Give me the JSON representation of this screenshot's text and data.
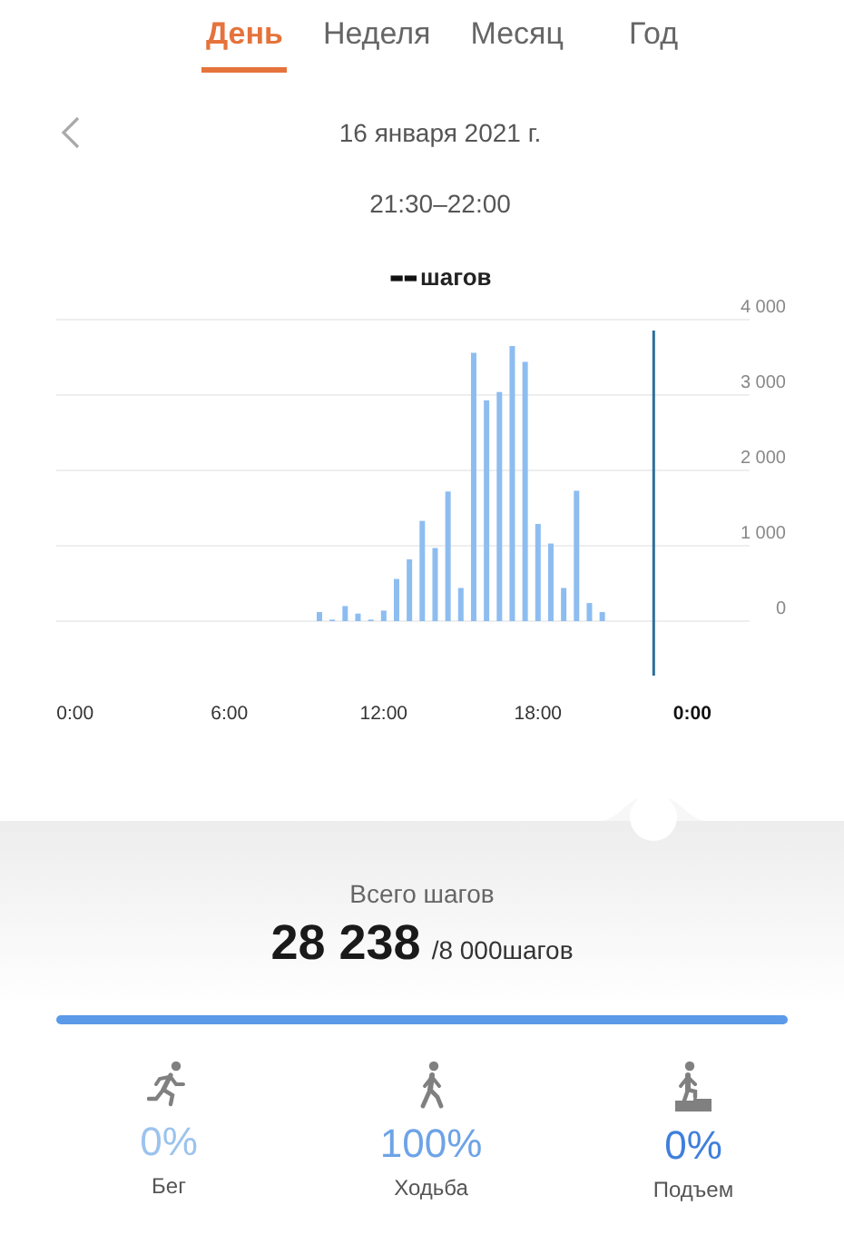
{
  "tabs": [
    {
      "label": "День",
      "selected": true
    },
    {
      "label": "Неделя",
      "selected": false
    },
    {
      "label": "Месяц",
      "selected": false
    },
    {
      "label": "Год",
      "selected": false
    }
  ],
  "date": "16 января 2021 г.",
  "time_range": "21:30–22:00",
  "selected_value": "--",
  "selected_unit": "шагов",
  "chart_data": {
    "type": "bar",
    "x": [
      9.5,
      10,
      10.5,
      11,
      11.5,
      12,
      12.5,
      13,
      13.5,
      14,
      14.5,
      15,
      15.5,
      16,
      16.5,
      17,
      17.5,
      18,
      18.5,
      19,
      19.5,
      20,
      20.5
    ],
    "series": [
      {
        "color": "#8dbdf0",
        "values": [
          120,
          20,
          200,
          100,
          20,
          140,
          560,
          820,
          1330,
          970,
          1720,
          440,
          3560,
          2930,
          3040,
          3650,
          3440,
          1290,
          1030,
          440,
          1730,
          240,
          120
        ]
      }
    ],
    "xlim": [
      0,
      24
    ],
    "ylim": [
      0,
      4000
    ],
    "grid": true,
    "ref_lines": [
      {
        "axis": "x",
        "value": 22.5,
        "color": "#2d6e9c"
      }
    ],
    "xticks": [
      {
        "value": 0,
        "label": "0:00"
      },
      {
        "value": 6,
        "label": "6:00"
      },
      {
        "value": 12,
        "label": "12:00"
      },
      {
        "value": 18,
        "label": "18:00"
      },
      {
        "value": 24,
        "label": "0:00"
      }
    ],
    "yticks": [
      {
        "value": 0,
        "label": "0"
      },
      {
        "value": 1000,
        "label": "1 000"
      },
      {
        "value": 2000,
        "label": "2 000"
      },
      {
        "value": 3000,
        "label": "3 000"
      },
      {
        "value": 4000,
        "label": "4 000"
      }
    ]
  },
  "total_label": "Всего шагов",
  "total_value": "28 238",
  "goal": "/8 000шагов",
  "activities": [
    {
      "kind": "run",
      "value": "0%",
      "label": "Бег",
      "color": "#9cc3ee"
    },
    {
      "kind": "walk",
      "value": "100%",
      "label": "Ходьба",
      "color": "#6ea3e6"
    },
    {
      "kind": "climb",
      "value": "0%",
      "label": "Подъем",
      "color": "#3f7fdc"
    }
  ]
}
